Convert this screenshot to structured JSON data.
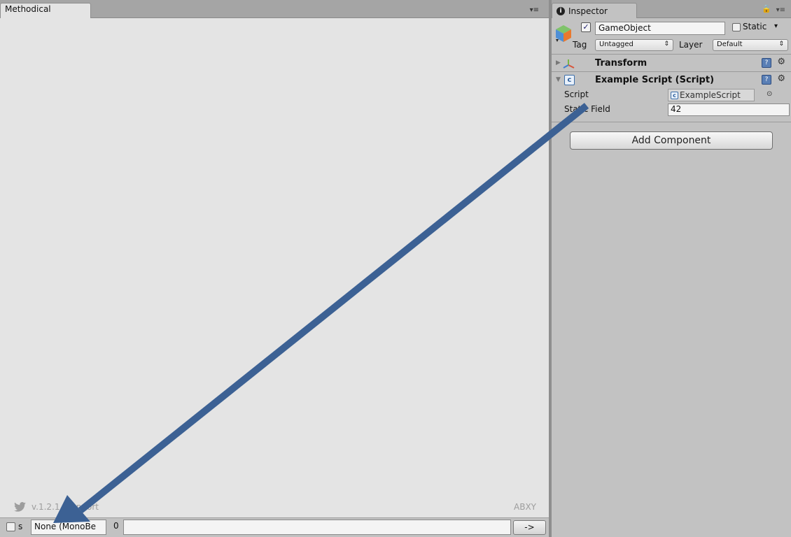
{
  "methodical": {
    "tab_title": "Methodical",
    "tab_menu": "▾≡",
    "version_text": "v.1.2.1",
    "support_text": "Support",
    "brand_text": "ABXY",
    "bottom": {
      "s_label": "s",
      "object_field": "None (MonoBe",
      "index": "0",
      "text_value": "",
      "go_label": "->"
    }
  },
  "inspector": {
    "tab_title": "Inspector",
    "lock_icon": "🔒",
    "tab_menu": "▾≡",
    "gameobject": {
      "name": "GameObject",
      "static_label": "Static",
      "static_arrow": "▾",
      "tag_label": "Tag",
      "tag_value": "Untagged",
      "layer_label": "Layer",
      "layer_value": "Default"
    },
    "components": {
      "transform_title": "Transform",
      "script_title": "Example Script (Script)",
      "script_label": "Script",
      "script_value": "ExampleScript",
      "static_field_label": "Static Field",
      "static_field_value": "42"
    },
    "add_component": "Add Component"
  },
  "colors": {
    "arrow": "#3c6194",
    "panel": "#c2c2c2",
    "canvas": "#e4e4e4"
  }
}
